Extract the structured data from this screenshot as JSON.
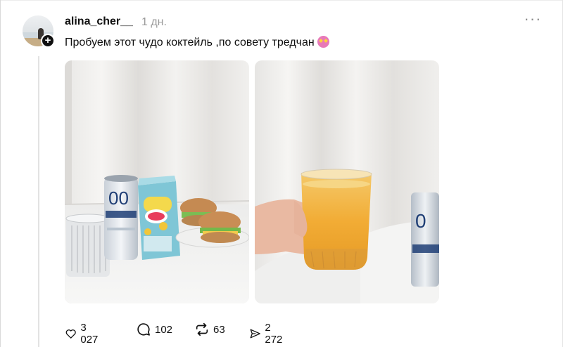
{
  "post": {
    "username": "alina_cher__",
    "timestamp": "1 дн.",
    "text": "Пробуем этот чудо коктейль ,по совету тредчан",
    "more_label": "···",
    "emoji_icon": "star-struck-emoji-icon",
    "follow_badge": "+"
  },
  "images": [
    {
      "name": "photo-breakfast-table",
      "can_text": "00"
    },
    {
      "name": "photo-hand-holding-juice",
      "can_text": "0"
    }
  ],
  "actions": {
    "likes": "3 027",
    "replies": "102",
    "reposts": "63",
    "shares": "2 272"
  }
}
